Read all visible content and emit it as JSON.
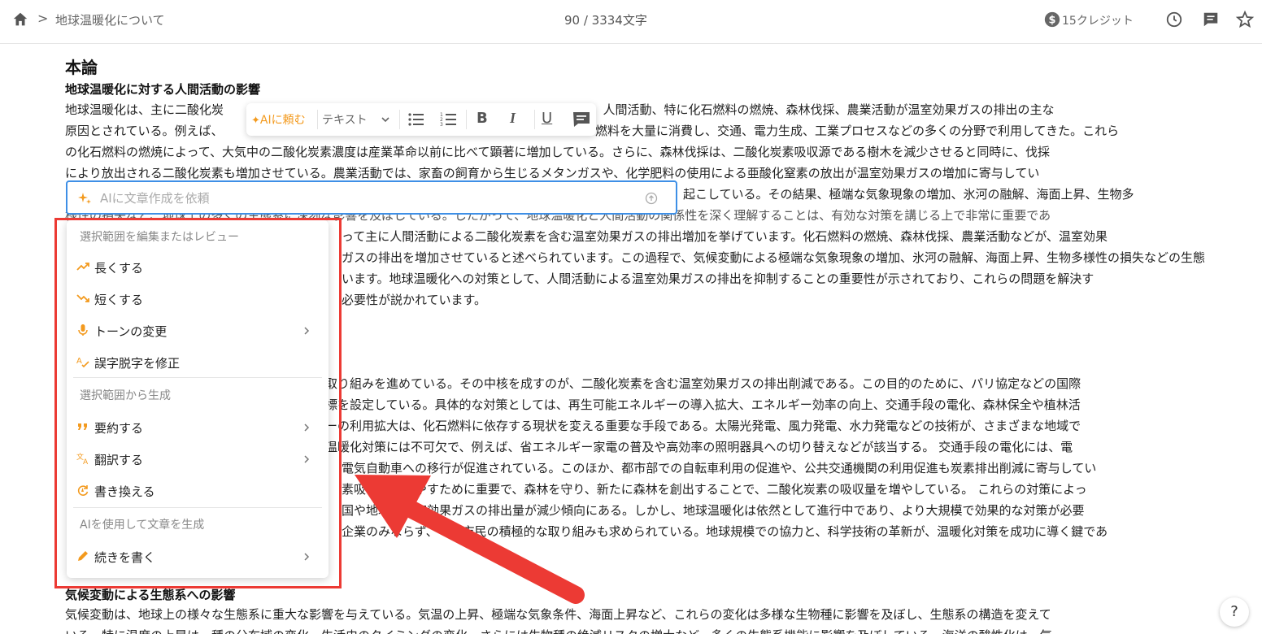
{
  "header": {
    "breadcrumb_sep": ">",
    "title": "地球温暖化について",
    "char_count": "90 / 3334文字",
    "credits": "15クレジット",
    "icons": [
      "home-icon",
      "credit-icon",
      "history-icon",
      "comment-icon",
      "star-icon"
    ]
  },
  "document": {
    "h1": "本論",
    "sections": [
      {
        "heading": "地球温暖化に対する人間活動の影響",
        "lines": [
          "地球温暖化は、主に二酸化炭",
          "行している。人間活動、特に化石燃料の燃焼、森林伐採、農業活動が温室効果ガスの排出の主な",
          "原因とされている。例えば、",
          "燃料を大量に消費し、交通、電力生成、工業プロセスなどの多くの分野で利用してきた。これら",
          "の化石燃料の燃焼によって、大気中の二酸化炭素濃度は産業革命以前に比べて顕著に増加している。さらに、森林伐採は、二酸化炭素吸収源である樹木を減少させると同時に、伐採",
          "により放出される二酸化炭素も増加させている。農業活動では、家畜の飼育から生じるメタンガスや、化学肥料の使用による亜酸化窒素の放出が温室効果ガスの増加に寄与してい",
          "起こしている。その結果、極端な気象現象の増加、氷河の融解、海面上昇、生物多",
          "様性の損失など、地球上の多くの生態系に深刻な影響を及ぼしている。したがって、地球温暖化と人間活動の関係性を深く理解することは、有効な対策を講じる上で非常に重要であ",
          "って主に人間活動による二酸化炭素を含む温室効果ガスの排出増加を挙げています。化石燃料の燃焼、森林伐採、農業活動などが、温室効果",
          "ガスの排出を増加させていると述べられています。この過程で、気候変動による極端な気象現象の増加、氷河の融解、海面上昇、生物多様性の損失などの生態",
          "います。地球温暖化への対策として、人間活動による温室効果ガスの排出を抑制することの重要性が示されており、これらの問題を解決す",
          "必要性が説かれています。"
        ]
      },
      {
        "lines": [
          "取り組みを進めている。その中核を成すのが、二酸化炭素を含む温室効果ガスの排出削減である。この目的のために、パリ協定などの国際",
          "標を設定している。具体的な対策としては、再生可能エネルギーの導入拡大、エネルギー効率の向上、交通手段の電化、森林保全や植林活",
          "ーの利用拡大は、化石燃料に依存する現状を変える重要な手段である。太陽光発電、風力発電、水力発電などの技術が、さまざまな地域で",
          "温暖化対策には不可欠で、例えば、省エネルギー家電の普及や高効率の照明器具への切り替えなどが該当する。 交通手段の電化には、電",
          "電気自動車への移行が促進されている。このほか、都市部での自転車利用の促進や、公共交通機関の利用促進も炭素排出削減に寄与してい",
          "素吸収源を増やすために重要で、森林を守り、新たに森林を創出することで、二酸化炭素の吸収量を増やしている。 これらの対策によっ",
          "国や地域で温室効果ガスの排出量が減少傾向にある。しかし、地球温暖化は依然として進行中であり、より大規模で効果的な対策が必要",
          "企業のみならず、一般市民の積極的な取り組みも求められている。地球規模での協力と、科学技術の革新が、温暖化対策を成功に導く鍵であ"
        ]
      },
      {
        "heading": "気候変動による生態系への影響",
        "lines": [
          "気候変動は、地球上の様々な生態系に重大な影響を与えている。気温の上昇、極端な気象条件、海面上昇など、これらの変化は多様な生物種に影響を及ぼし、生態系の構造を変えて",
          "いる。特に温度の上昇は、種の分布域の変化、生活史のタイミングの変化、さらには生物種の絶滅リスクの増大など、多くの生態系機能に影響を及ぼしている。海洋の酸性化は、気"
        ]
      }
    ]
  },
  "format_toolbar": {
    "ai_label": "AIに頼む",
    "text_style": "テキスト",
    "buttons": [
      "bullet-list",
      "numbered-list",
      "bold",
      "italic",
      "underline",
      "comment"
    ],
    "bold": "B",
    "italic": "I",
    "underline": "U"
  },
  "ai_prompt": {
    "placeholder": "AIに文章作成を依頼",
    "value": ""
  },
  "menu": {
    "groups": [
      {
        "header": "選択範囲を編集またはレビュー",
        "items": [
          {
            "label": "長くする",
            "icon": "trend-up-icon",
            "submenu": false
          },
          {
            "label": "短くする",
            "icon": "trend-down-icon",
            "submenu": false
          },
          {
            "label": "トーンの変更",
            "icon": "microphone-icon",
            "submenu": true
          },
          {
            "label": "誤字脱字を修正",
            "icon": "spellcheck-icon",
            "submenu": false
          }
        ]
      },
      {
        "header": "選択範囲から生成",
        "items": [
          {
            "label": "要約する",
            "icon": "quote-icon",
            "submenu": true
          },
          {
            "label": "翻訳する",
            "icon": "translate-icon",
            "submenu": true
          },
          {
            "label": "書き換える",
            "icon": "rewrite-icon",
            "submenu": false
          }
        ]
      },
      {
        "header": "AIを使用して文章を生成",
        "items": [
          {
            "label": "続きを書く",
            "icon": "pencil-icon",
            "submenu": true
          }
        ]
      }
    ]
  },
  "help": "?",
  "colors": {
    "accent_orange": "#f39a1e",
    "input_border": "#3e8fe6",
    "annotation_red": "#ec3a34"
  }
}
